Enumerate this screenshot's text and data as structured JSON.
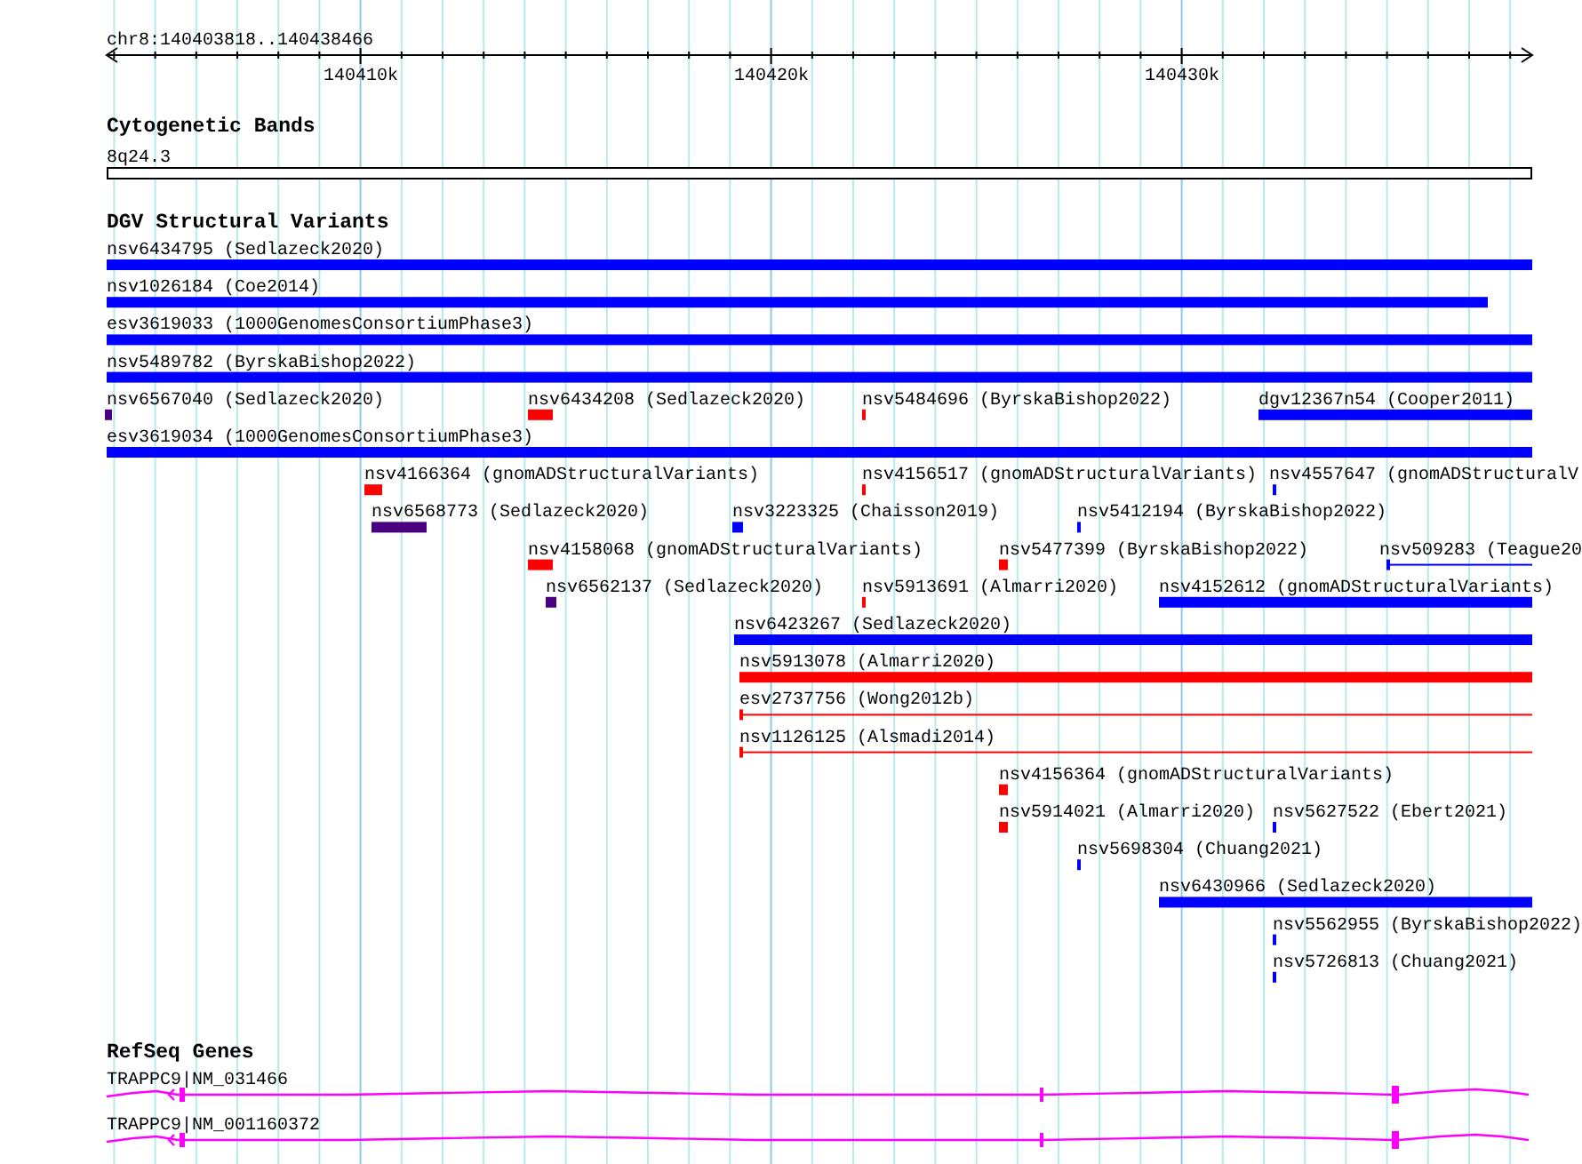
{
  "ruler": {
    "locus": "chr8:140403818..140438466",
    "ticks": [
      "140410k",
      "140420k",
      "140430k"
    ]
  },
  "tracks": [
    {
      "kind": "bands",
      "title": "Cytogenetic Bands",
      "bands": [
        {
          "label": "8q24.3"
        }
      ]
    },
    {
      "kind": "variants",
      "title": "DGV Structural Variants",
      "features": [
        {
          "label": "nsv6434795 (Sedlazeck2020)",
          "color": "#0000ff",
          "kind": "bar"
        },
        {
          "label": "nsv1026184 (Coe2014)",
          "color": "#0000ff",
          "kind": "bar"
        },
        {
          "label": "esv3619033 (1000GenomesConsortiumPhase3)",
          "color": "#0000ff",
          "kind": "bar"
        },
        {
          "label": "nsv5489782 (ByrskaBishop2022)",
          "color": "#0000ff",
          "kind": "bar"
        },
        {
          "label": "nsv6567040 (Sedlazeck2020)",
          "color": "#4b0082",
          "kind": "bar"
        },
        {
          "label": "nsv6434208 (Sedlazeck2020)",
          "color": "#ff0000",
          "kind": "bar"
        },
        {
          "label": "nsv5484696 (ByrskaBishop2022)",
          "color": "#ff0000",
          "kind": "bar"
        },
        {
          "label": "dgv12367n54 (Cooper2011)",
          "color": "#0000ff",
          "kind": "bar"
        },
        {
          "label": "esv3619034 (1000GenomesConsortiumPhase3)",
          "color": "#0000ff",
          "kind": "bar"
        },
        {
          "label": "nsv4166364 (gnomADStructuralVariants)",
          "color": "#ff0000",
          "kind": "bar"
        },
        {
          "label": "nsv4156517 (gnomADStructuralVariants)",
          "color": "#ff0000",
          "kind": "bar"
        },
        {
          "label": "nsv4557647 (gnomADStructuralV",
          "color": "#0000ff",
          "kind": "bar"
        },
        {
          "label": "nsv6568773 (Sedlazeck2020)",
          "color": "#4b0082",
          "kind": "bar"
        },
        {
          "label": "nsv3223325 (Chaisson2019)",
          "color": "#0000ff",
          "kind": "bar"
        },
        {
          "label": "nsv5412194 (ByrskaBishop2022)",
          "color": "#0000ff",
          "kind": "bar"
        },
        {
          "label": "nsv4158068 (gnomADStructuralVariants)",
          "color": "#ff0000",
          "kind": "bar"
        },
        {
          "label": "nsv5477399 (ByrskaBishop2022)",
          "color": "#ff0000",
          "kind": "bar"
        },
        {
          "label": "nsv509283 (Teague20",
          "color": "#0000ff",
          "kind": "line"
        },
        {
          "label": "nsv6562137 (Sedlazeck2020)",
          "color": "#4b0082",
          "kind": "bar"
        },
        {
          "label": "nsv5913691 (Almarri2020)",
          "color": "#ff0000",
          "kind": "bar"
        },
        {
          "label": "nsv4152612 (gnomADStructuralVariants)",
          "color": "#0000ff",
          "kind": "bar"
        },
        {
          "label": "nsv6423267 (Sedlazeck2020)",
          "color": "#0000ff",
          "kind": "bar"
        },
        {
          "label": "nsv5913078 (Almarri2020)",
          "color": "#ff0000",
          "kind": "bar"
        },
        {
          "label": "esv2737756 (Wong2012b)",
          "color": "#ff0000",
          "kind": "line"
        },
        {
          "label": "nsv1126125 (Alsmadi2014)",
          "color": "#ff0000",
          "kind": "line"
        },
        {
          "label": "nsv4156364 (gnomADStructuralVariants)",
          "color": "#ff0000",
          "kind": "bar"
        },
        {
          "label": "nsv5914021 (Almarri2020)",
          "color": "#ff0000",
          "kind": "bar"
        },
        {
          "label": "nsv5627522 (Ebert2021)",
          "color": "#0000ff",
          "kind": "bar"
        },
        {
          "label": "nsv5698304 (Chuang2021)",
          "color": "#0000ff",
          "kind": "bar"
        },
        {
          "label": "nsv6430966 (Sedlazeck2020)",
          "color": "#0000ff",
          "kind": "bar"
        },
        {
          "label": "nsv5562955 (ByrskaBishop2022)",
          "color": "#0000ff",
          "kind": "bar"
        },
        {
          "label": "nsv5726813 (Chuang2021)",
          "color": "#0000ff",
          "kind": "bar"
        }
      ]
    },
    {
      "kind": "genes",
      "title": "RefSeq Genes",
      "genes": [
        {
          "label": "TRAPPC9|NM_031466"
        },
        {
          "label": "TRAPPC9|NM_001160372"
        }
      ]
    }
  ]
}
